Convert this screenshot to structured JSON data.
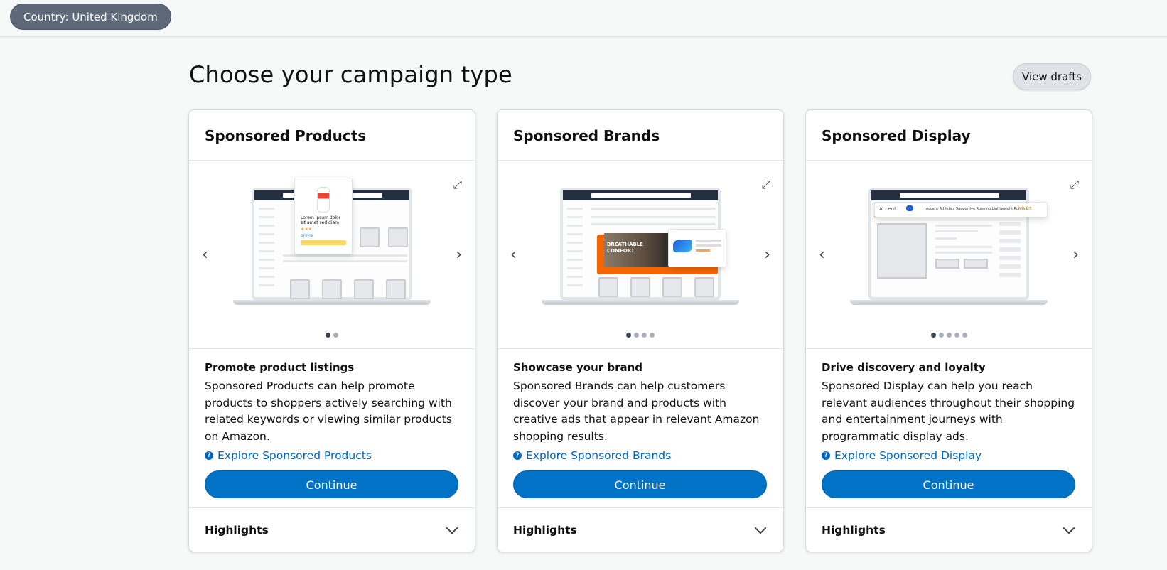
{
  "topbar": {
    "country_label": "Country: United Kingdom"
  },
  "header": {
    "title": "Choose your campaign type",
    "view_drafts": "View drafts"
  },
  "cards": [
    {
      "title": "Sponsored Products",
      "subtitle": "Promote product listings",
      "description": "Sponsored Products can help promote products to shoppers actively searching with related keywords or viewing similar products on Amazon.",
      "explore": "Explore Sponsored Products",
      "continue": "Continue",
      "highlights": "Highlights",
      "carousel_pages": 2,
      "carousel_active": 1
    },
    {
      "title": "Sponsored Brands",
      "subtitle": "Showcase your brand",
      "description": "Sponsored Brands can help customers discover your brand and products with creative ads that appear in relevant Amazon shopping results.",
      "explore": "Explore Sponsored Brands",
      "continue": "Continue",
      "highlights": "Highlights",
      "carousel_pages": 4,
      "carousel_active": 1
    },
    {
      "title": "Sponsored Display",
      "subtitle": "Drive discovery and loyalty",
      "description": "Sponsored Display can help you reach relevant audiences throughout their shopping and entertainment journeys with programmatic display ads.",
      "explore": "Explore Sponsored Display",
      "continue": "Continue",
      "highlights": "Highlights",
      "carousel_pages": 5,
      "carousel_active": 1
    }
  ],
  "illustration_text": {
    "products_popup": "Lorem ipsum dolor sit amet sed diam",
    "products_prime": "prime",
    "brands_banner": "BREATHABLE COMFORT",
    "display_brand": "Accent",
    "display_headline": "Accent Athletics Supportive Running Lightweight Running..."
  },
  "colors": {
    "accent_blue": "#0073c7",
    "link_blue": "#0066c0",
    "pill_gray": "#5d6878",
    "brand_orange": "#f56600"
  }
}
